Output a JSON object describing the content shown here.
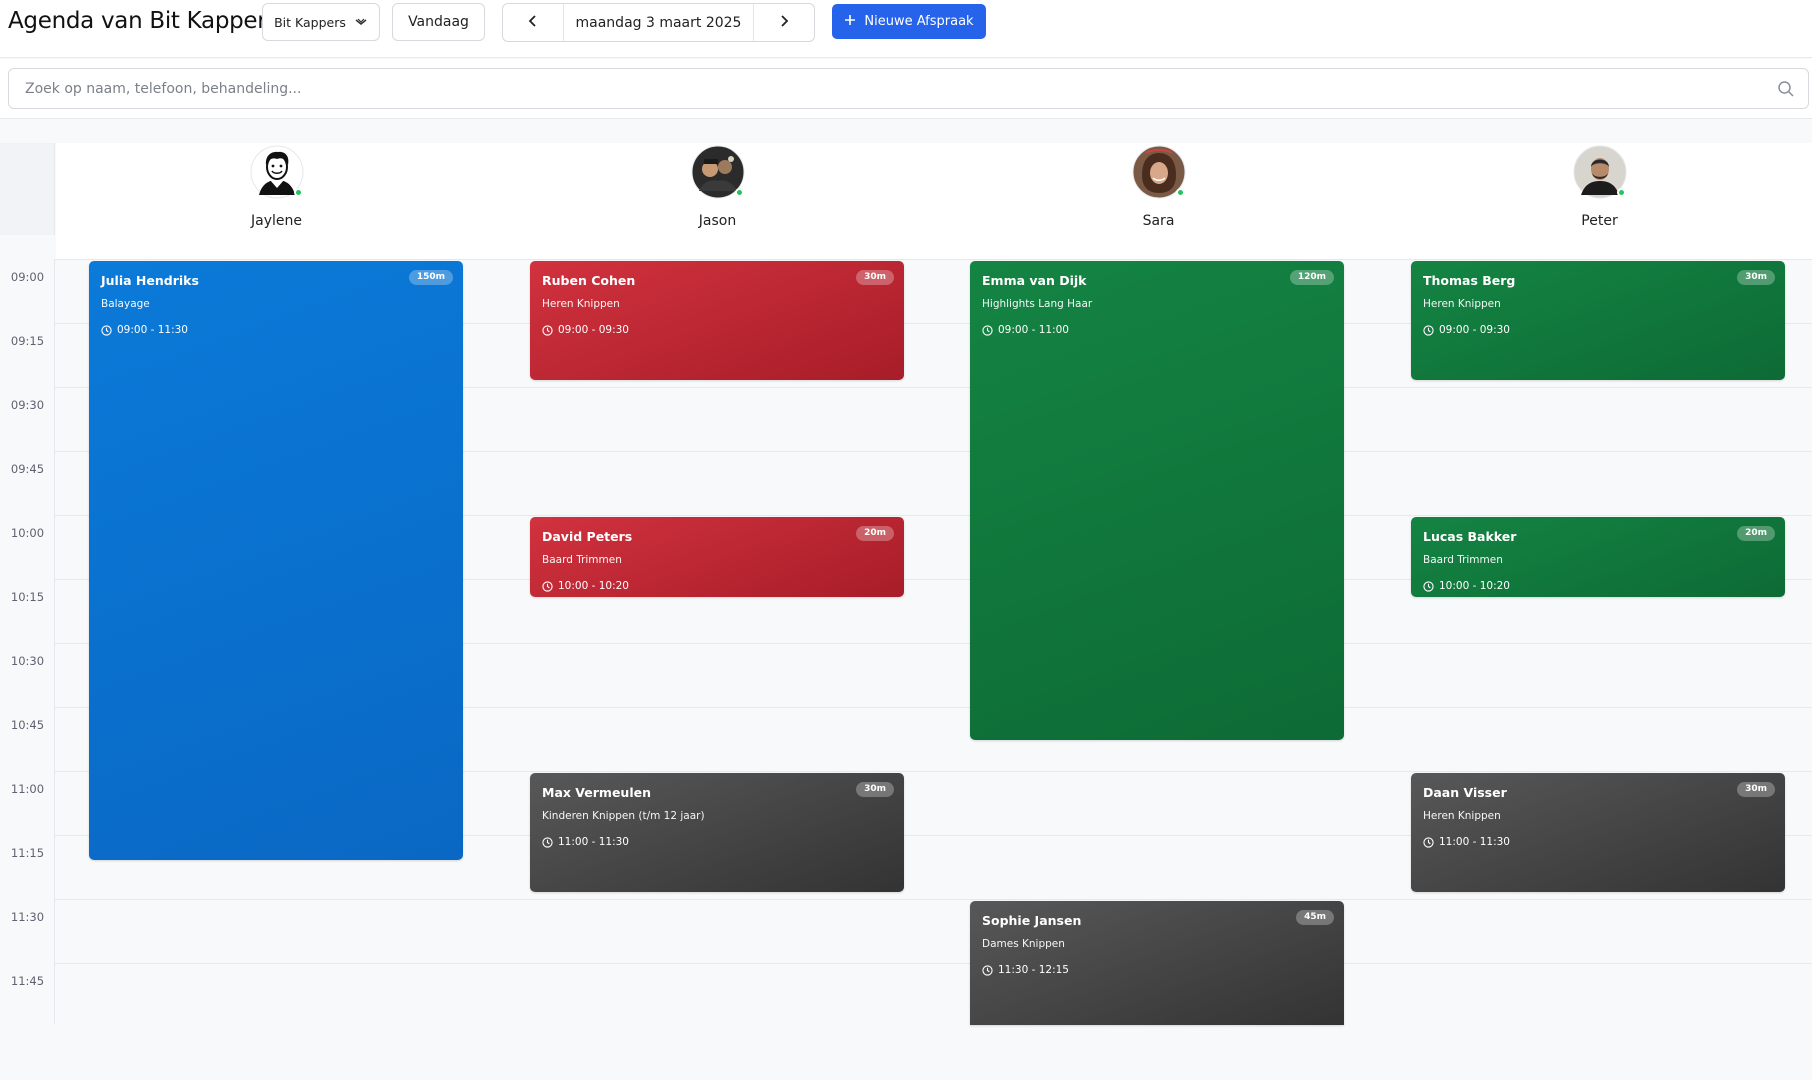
{
  "header": {
    "title": "Agenda van Bit Kappers",
    "salon_select": "Bit Kappers",
    "today_label": "Vandaag",
    "date_label": "maandag 3 maart 2025",
    "new_button_label": "Nieuwe Afspraak"
  },
  "search": {
    "placeholder": "Zoek op naam, telefoon, behandeling..."
  },
  "staff": [
    {
      "name": "Jaylene",
      "avatar": "person-silhouette-icon"
    },
    {
      "name": "Jason",
      "avatar": "photo-jason"
    },
    {
      "name": "Sara",
      "avatar": "photo-sara"
    },
    {
      "name": "Peter",
      "avatar": "photo-peter"
    }
  ],
  "time_slots": [
    "09:00",
    "09:15",
    "09:30",
    "09:45",
    "10:00",
    "10:15",
    "10:30",
    "10:45",
    "11:00",
    "11:15",
    "11:30",
    "11:45"
  ],
  "colors": {
    "accent": "#2563eb",
    "blue": "#0b74d2",
    "red": "#c22a36",
    "green": "#117a3d",
    "gray": "#484848"
  },
  "appointments": [
    {
      "name": "Julia Hendriks",
      "service": "Balayage",
      "time": "09:00 - 11:30",
      "duration": "150m"
    },
    {
      "name": "Ruben Cohen",
      "service": "Heren Knippen",
      "time": "09:00 - 09:30",
      "duration": "30m"
    },
    {
      "name": "David Peters",
      "service": "Baard Trimmen",
      "time": "10:00 - 10:20",
      "duration": "20m"
    },
    {
      "name": "Max Vermeulen",
      "service": "Kinderen Knippen (t/m 12 jaar)",
      "time": "11:00 - 11:30",
      "duration": "30m"
    },
    {
      "name": "Emma van Dijk",
      "service": "Highlights Lang Haar",
      "time": "09:00 - 11:00",
      "duration": "120m"
    },
    {
      "name": "Sophie Jansen",
      "service": "Dames Knippen",
      "time": "11:30 - 12:15",
      "duration": "45m"
    },
    {
      "name": "Thomas Berg",
      "service": "Heren Knippen",
      "time": "09:00 - 09:30",
      "duration": "30m"
    },
    {
      "name": "Lucas Bakker",
      "service": "Baard Trimmen",
      "time": "10:00 - 10:20",
      "duration": "20m"
    },
    {
      "name": "Daan Visser",
      "service": "Heren Knippen",
      "time": "11:00 - 11:30",
      "duration": "30m"
    }
  ]
}
